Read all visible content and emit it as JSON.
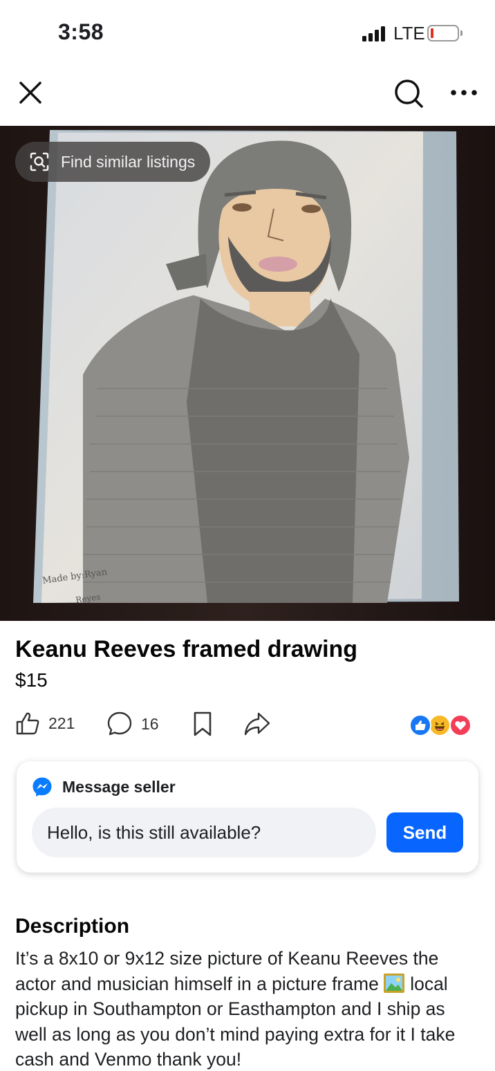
{
  "status_bar": {
    "time": "3:58",
    "network": "LTE"
  },
  "nav": {
    "close_icon": "close-icon",
    "search_icon": "search-icon",
    "more_icon": "more-icon"
  },
  "photo": {
    "find_similar_label": "Find similar listings"
  },
  "listing": {
    "title": "Keanu Reeves framed drawing",
    "price": "$15"
  },
  "actions": {
    "like_count": "221",
    "comment_count": "16"
  },
  "reactions": [
    "like",
    "haha",
    "love"
  ],
  "message": {
    "heading": "Message seller",
    "input_value": "Hello, is this still available?",
    "send_label": "Send"
  },
  "description": {
    "heading": "Description",
    "body": "It’s a 8x10 or 9x12 size picture of Keanu Reeves the actor and musician himself in a picture frame",
    "body_cont": "local pickup in Southampton or Easthampton and I ship as well as long as you don’t mind paying extra for it I take cash and Venmo thank you!"
  },
  "colors": {
    "accent": "#0866ff",
    "messenger": "#0a7cff"
  }
}
